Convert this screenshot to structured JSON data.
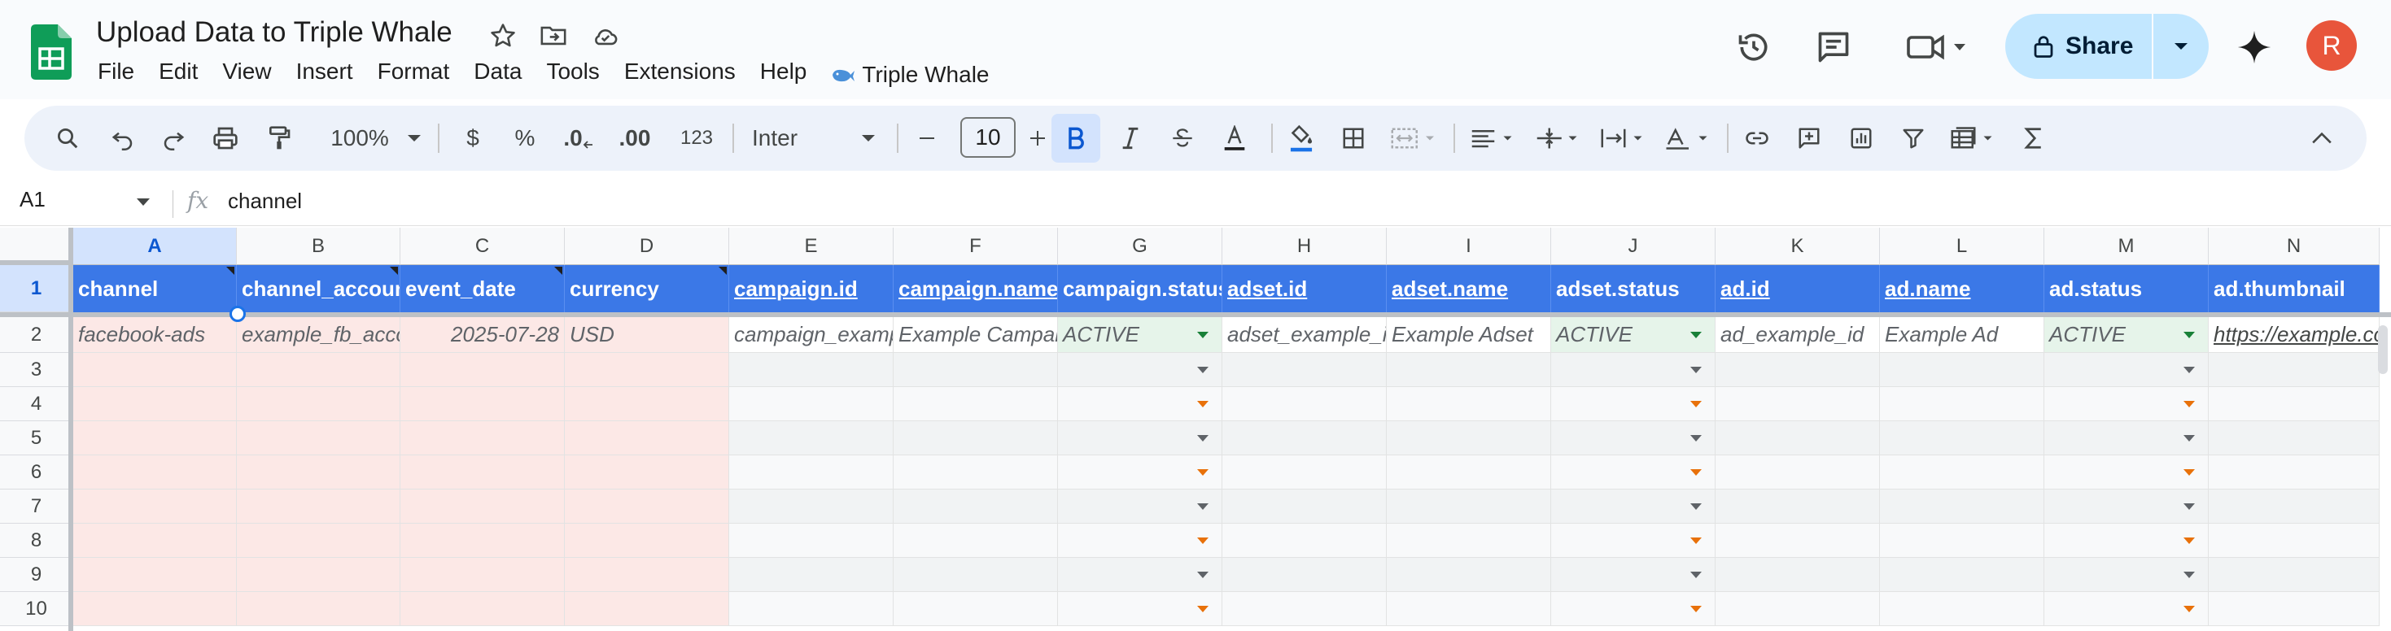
{
  "doc": {
    "title": "Upload Data to Triple Whale",
    "menu": [
      "File",
      "Edit",
      "View",
      "Insert",
      "Format",
      "Data",
      "Tools",
      "Extensions",
      "Help"
    ],
    "extension_menu": "Triple Whale"
  },
  "header_actions": {
    "share_label": "Share",
    "avatar_initial": "R",
    "avatar_color": "#e8553b"
  },
  "toolbar": {
    "zoom": "100%",
    "currency": "$",
    "percent": "%",
    "decrease_decimals": ".0",
    "increase_decimals": ".00",
    "number_format": "123",
    "font": "Inter",
    "font_size": "10"
  },
  "formula_bar": {
    "cell_ref": "A1",
    "fx": "fx",
    "content": "channel"
  },
  "columns": [
    "A",
    "B",
    "C",
    "D",
    "E",
    "F",
    "G",
    "H",
    "I",
    "J",
    "K",
    "L",
    "M",
    "N"
  ],
  "rows": [
    "1",
    "2",
    "3",
    "4",
    "5",
    "6",
    "7",
    "8",
    "9",
    "10"
  ],
  "header_row": [
    "channel",
    "channel_account_id",
    "event_date",
    "currency",
    "campaign.id",
    "campaign.name",
    "campaign.status",
    "adset.id",
    "adset.name",
    "adset.status",
    "ad.id",
    "ad.name",
    "ad.status",
    "ad.thumbnail"
  ],
  "example_row": [
    "facebook-ads",
    "example_fb_account",
    "2025-07-28",
    "USD",
    "campaign_example_id",
    "Example Campaign",
    "ACTIVE",
    "adset_example_id",
    "Example Adset",
    "ACTIVE",
    "ad_example_id",
    "Example Ad",
    "ACTIVE",
    "https://example.com"
  ],
  "colors": {
    "header_bg": "#3b78e7",
    "required_bg": "#fce8e6",
    "status_bg": "#e6f4ea",
    "selection": "#d3e3fd"
  }
}
